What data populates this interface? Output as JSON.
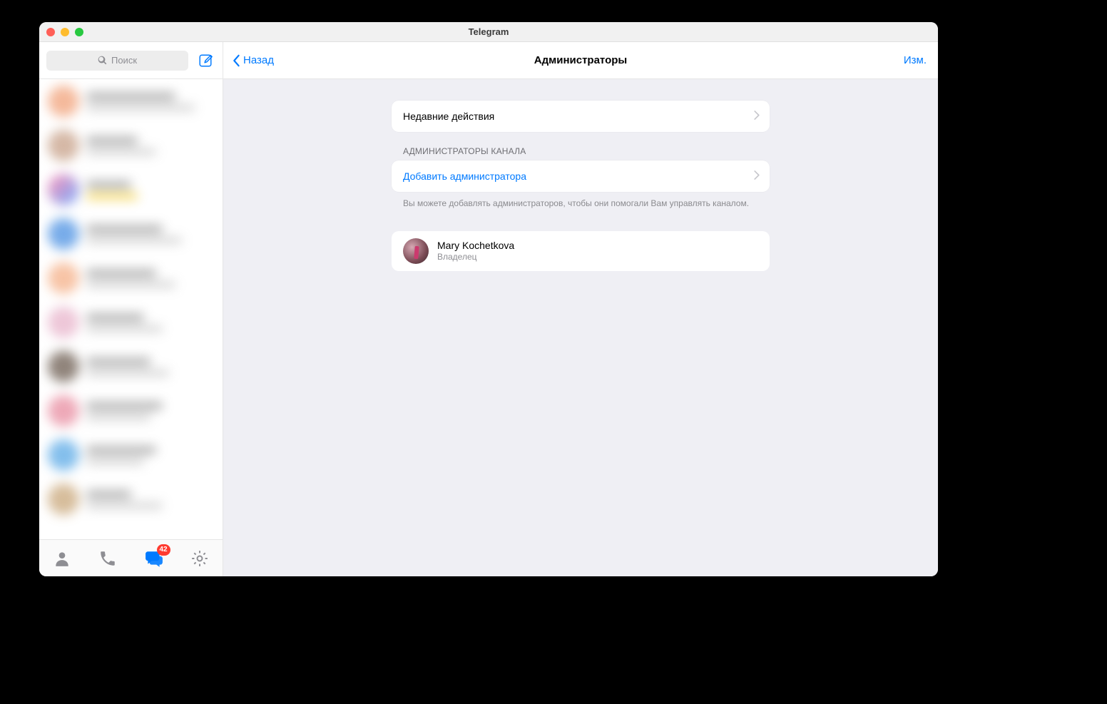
{
  "window": {
    "title": "Telegram"
  },
  "sidebar": {
    "search_placeholder": "Поиск",
    "badge_count": "42"
  },
  "header": {
    "back_label": "Назад",
    "title": "Администраторы",
    "edit_label": "Изм."
  },
  "content": {
    "recent_actions": "Недавние действия",
    "section_label": "АДМИНИСТРАТОРЫ КАНАЛА",
    "add_admin": "Добавить администратора",
    "section_footer": "Вы можете добавлять администраторов, чтобы они помогали Вам управлять каналом.",
    "admin": {
      "name": "Mary Kochetkova",
      "role": "Владелец"
    }
  }
}
